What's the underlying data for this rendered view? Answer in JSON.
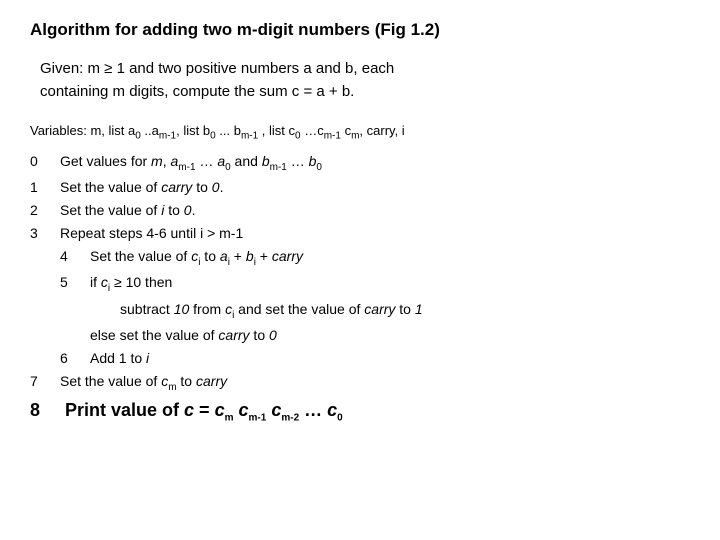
{
  "title": "Algorithm for adding two m-digit numbers (Fig 1.2)",
  "given_line1": "Given: m ≥ 1 and two positive numbers a and b, each",
  "given_line2": "containing m digits, compute the sum c = a + b.",
  "variables": "Variables: m, list a₀ ..aₘ₋₁, list b₀ ... bₘ₋₁ , list c₀ …cₘ₋₁ cₘ, carry, i",
  "steps": {
    "s0_num": "0",
    "s0_text_pre": "Get values for m, a",
    "s0_text_mid": "m-1",
    "s0_text_mid2": "… a",
    "s0_text_mid3": "0",
    "s0_text_mid4": "and b",
    "s0_text_mid5": "m-1",
    "s0_text_end": "… b",
    "s0_text_end2": "0",
    "s1_num": "1",
    "s1_text": "Set the value of carry to 0.",
    "s2_num": "2",
    "s2_text": "Set the value of i to 0.",
    "s3_num": "3",
    "s3_text": "Repeat steps 4-6 until i > m-1",
    "s4_num": "4",
    "s4_text_pre": "Set the value of c",
    "s4_text_sub": "i",
    "s4_text_mid": "to a",
    "s4_text_sub2": "i",
    "s4_text_end": "+ b",
    "s4_text_sub3": "i",
    "s4_text_end2": "+ carry",
    "s5_num": "5",
    "s5_text_pre": "if c",
    "s5_text_sub": "i",
    "s5_text_end": "≥ 10 then",
    "s5a_text_pre": "subtract 10 from c",
    "s5a_text_sub": "i",
    "s5a_text_end": "and set the value of carry to 1",
    "s5b_text": "else set the value of carry to 0",
    "s6_num": "6",
    "s6_text": "Add 1 to i",
    "s7_num": "7",
    "s7_text_pre": "Set the value of c",
    "s7_text_sub": "m",
    "s7_text_end": "to carry",
    "s8_num": "8",
    "s8_text_pre": "Print value of c = c",
    "s8_sub1": "m",
    "s8_text2": "c",
    "s8_sub2": "m-1",
    "s8_text3": "c",
    "s8_sub3": "m-2",
    "s8_text4": "… c",
    "s8_sub4": "0"
  }
}
